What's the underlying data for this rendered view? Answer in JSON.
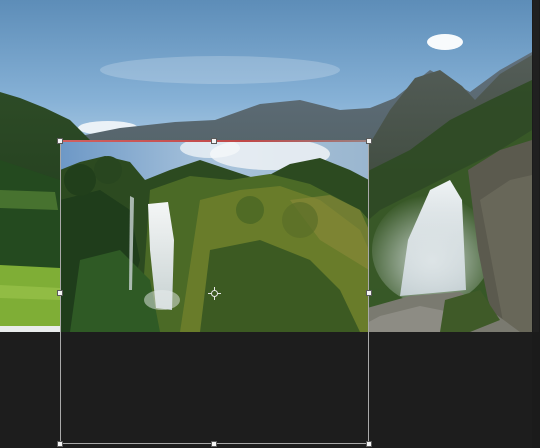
{
  "canvas": {
    "background": "#1d1d1d",
    "scene": "mountain-waterfall-photo",
    "layer": "waterfall-forest-photo"
  },
  "colors": {
    "sky_top": "#5d8db8",
    "sky_bottom": "#d8e6ef",
    "selection_outline": "#a9a9a9",
    "top_edge_highlight": "#c04848"
  },
  "transform": {
    "handles": [
      "top-left",
      "top-middle",
      "top-right",
      "middle-left",
      "middle-right",
      "bottom-left",
      "bottom-middle",
      "bottom-right"
    ],
    "pivot_icon": "crosshair-icon"
  }
}
